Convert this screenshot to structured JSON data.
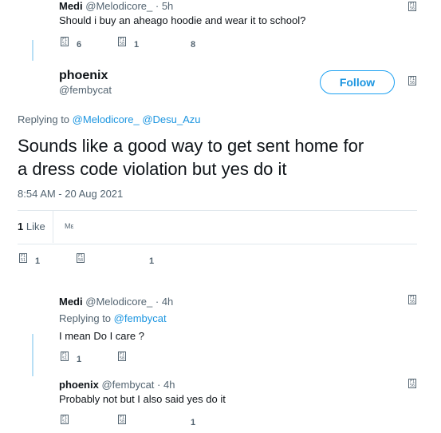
{
  "top_tweet": {
    "name": "Medi",
    "handle": "@Melodicore_",
    "time": "· 5h",
    "text": "Should i buy an aheago hoodie and wear it to school?",
    "reply_count": "6",
    "retweet_count": "1",
    "like_count": "8"
  },
  "main_tweet": {
    "name": "phoenix",
    "handle": "@fembycat",
    "follow_label": "Follow",
    "replying_prefix": "Replying to",
    "replying_to_1": "@Melodicore_",
    "replying_to_2": "@Desu_Azu",
    "text_line1": "Sounds like a good way to get sent home for",
    "text_line2": "a dress code violation but yes do it",
    "timestamp": "8:54 AM - 20 Aug 2021",
    "like_count": "1",
    "like_label": "Like",
    "avatars_placeholder": "Mε",
    "reply_count": "1",
    "like_action_count": "1"
  },
  "reply1": {
    "name": "Medi",
    "handle": "@Melodicore_",
    "time": "· 4h",
    "replying_prefix": "Replying to",
    "replying_to": "@fembycat",
    "text": "I mean Do I care ?",
    "reply_count": "1"
  },
  "reply2": {
    "name": "phoenix",
    "handle": "@fembycat",
    "time": "· 4h",
    "text": "Probably not but I also said yes do it",
    "like_count": "1"
  },
  "icon_glyph_labels": {
    "reply": "F1\n51",
    "retweet": "F1\n58",
    "caret": "F1\n56"
  }
}
